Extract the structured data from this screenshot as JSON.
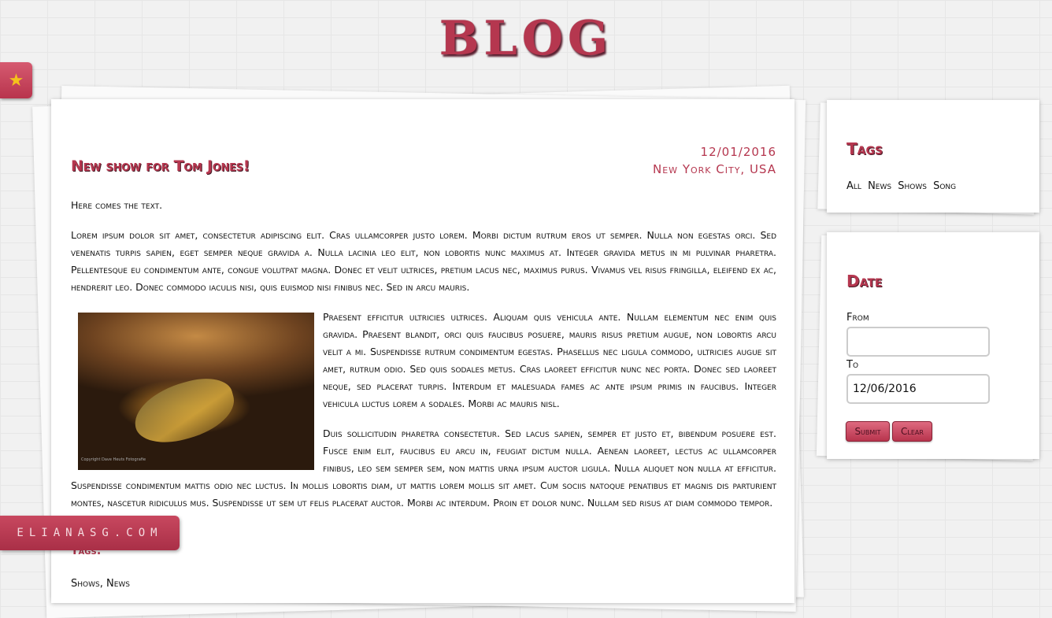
{
  "header": {
    "title": "BLOG"
  },
  "favorite": {
    "icon": "star-icon",
    "glyph": "★"
  },
  "post": {
    "title": "New show for Tom Jones!",
    "date": "12/01/2016",
    "location": "New York City, USA",
    "intro": "Here comes the text.",
    "paragraph1": "Lorem ipsum dolor sit amet, consectetur adipiscing elit. Cras ullamcorper justo lorem. Morbi dictum rutrum eros ut semper. Nulla non egestas orci. Sed venenatis turpis sapien, eget semper neque gravida a. Nulla lacinia leo elit, non lobortis nunc maximus at. Integer gravida metus in mi pulvinar pharetra. Pellentesque eu condimentum ante, congue volutpat magna. Donec et velit ultrices, pretium lacus nec, maximus purus. Vivamus vel risus fringilla, eleifend ex ac, hendrerit leo. Donec commodo iaculis nisi, quis euismod nisi finibus nec. Sed in arcu mauris.",
    "paragraph2": "Praesent efficitur ultricies ultrices. Aliquam quis vehicula ante. Nullam elementum nec enim quis gravida. Praesent blandit, orci quis faucibus posuere, mauris risus pretium augue, non lobortis arcu velit a mi. Suspendisse rutrum condimentum egestas. Phasellus nec ligula commodo, ultricies augue sit amet, rutrum odio. Sed quis sodales metus. Cras laoreet efficitur nunc nec porta. Donec sed laoreet neque, sed placerat turpis. Interdum et malesuada fames ac ante ipsum primis in faucibus. Integer vehicula luctus lorem a sodales. Morbi ac mauris nisl.",
    "paragraph3": "Duis sollicitudin pharetra consectetur. Sed lacus sapien, semper et justo et, bibendum posuere est. Fusce enim elit, faucibus eu arcu in, feugiat dictum nulla. Aenean laoreet, lectus ac ullamcorper finibus, leo sem semper sem, non mattis urna ipsum auctor ligula. Nulla aliquet non nulla at efficitur. Suspendisse condimentum mattis odio nec luctus. In mollis lobortis diam, ut mattis lorem mollis sit amet. Cum sociis natoque penatibus et magnis dis parturient montes, nascetur ridiculus mus. Suspendisse ut sem ut felis placerat auctor. Morbi ac interdum. Proin et dolor nunc. Nullam sed risus at diam commodo tempor.",
    "image_caption": "Copyright Dave Heuts Fotografie",
    "tags_label": "Tags:",
    "tags_value": "Shows, News"
  },
  "sidebar": {
    "tags": {
      "title": "Tags",
      "items": [
        "All",
        "News",
        "Shows",
        "Song"
      ]
    },
    "date": {
      "title": "Date",
      "from_label": "From",
      "from_value": "",
      "to_label": "To",
      "to_value": "12/06/2016",
      "submit_label": "Submit",
      "clear_label": "Clear"
    }
  },
  "site_badge": "ELIANASG.COM",
  "colors": {
    "accent": "#b5374f",
    "background": "#f1f1f1",
    "paper": "#ffffff"
  }
}
